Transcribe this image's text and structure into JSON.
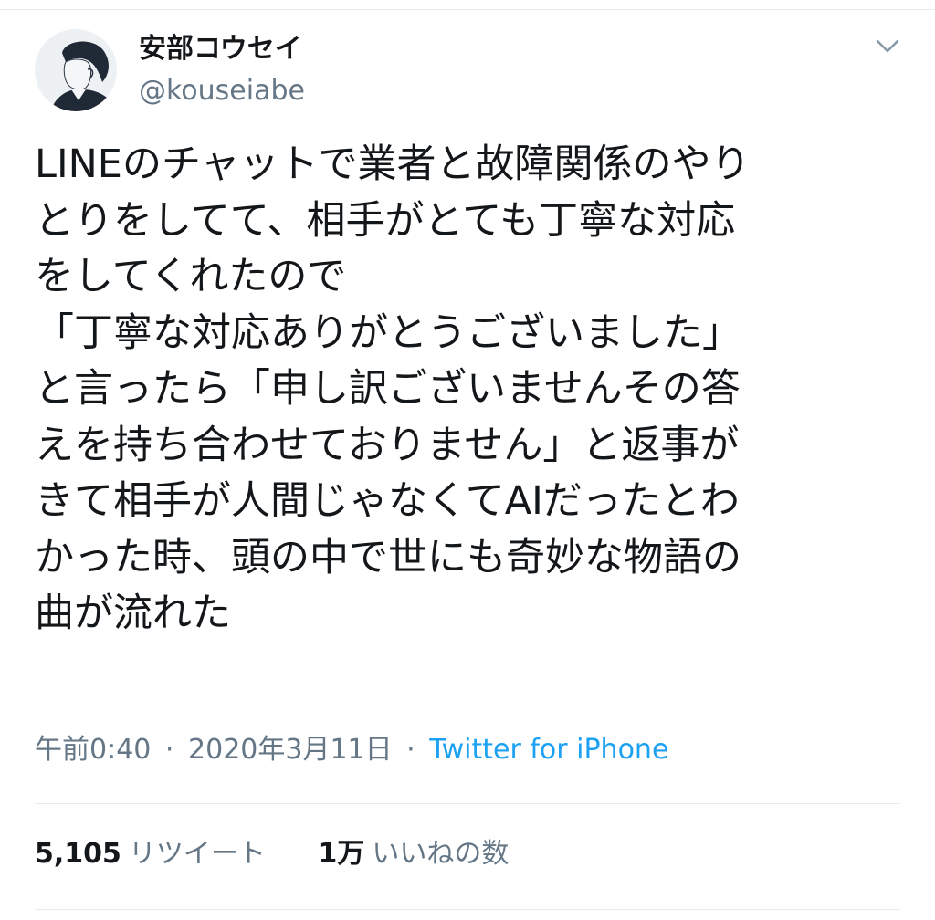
{
  "author": {
    "display_name": "安部コウセイ",
    "handle": "@kouseiabe",
    "avatar_icon": "profile-avatar"
  },
  "menu_icon": "chevron-down-icon",
  "tweet": {
    "text": "LINEのチャットで業者と故障関係のやり\nとりをしてて、相手がとても丁寧な対応\nをしてくれたので\n「丁寧な対応ありがとうございました」\nと言ったら「申し訳ございませんその答\nえを持ち合わせておりません」と返事が\nきて相手が人間じゃなくてAIだったとわ\nかった時、頭の中で世にも奇妙な物語の\n曲が流れた"
  },
  "meta": {
    "time": "午前0:40",
    "separator": "·",
    "date": "2020年3月11日",
    "source": "Twitter for iPhone"
  },
  "stats": {
    "retweets_count": "5,105",
    "retweets_label": "リツイート",
    "likes_count": "1万",
    "likes_label": "いいねの数"
  },
  "colors": {
    "text": "#14171a",
    "secondary": "#657786",
    "link": "#1da1f2",
    "divider": "#e6ecf0"
  }
}
